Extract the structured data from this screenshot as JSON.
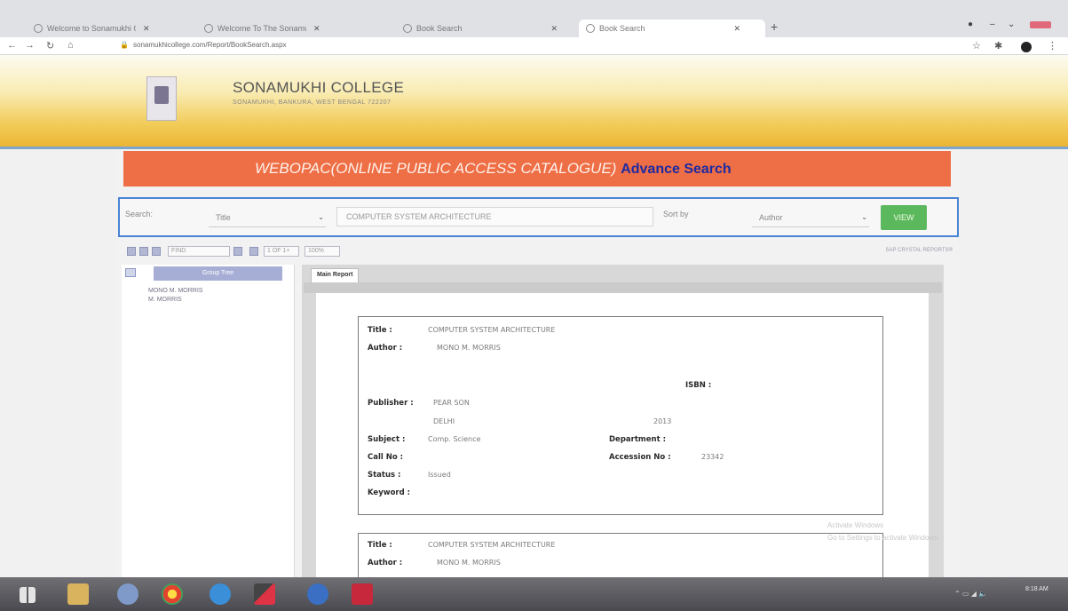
{
  "browser": {
    "tabs": [
      {
        "title": "Welcome to Sonamukhi College"
      },
      {
        "title": "Welcome To The Sonamukhi Co"
      },
      {
        "title": "Book Search"
      },
      {
        "title": "Book Search"
      }
    ],
    "new_tab": "+",
    "url": "sonamukhicollege.com/Report/BookSearch.aspx"
  },
  "college": {
    "name": "SONAMUKHI COLLEGE",
    "address": "SONAMUKHI, BANKURA, WEST BENGAL 722207"
  },
  "banner": {
    "main": "WEBOPAC(ONLINE PUBLIC ACCESS CATALOGUE)",
    "advance": "Advance Search"
  },
  "search": {
    "label": "Search:",
    "field_value": "Title",
    "query": "COMPUTER SYSTEM ARCHITECTURE",
    "sort_label": "Sort by",
    "sort_value": "Author",
    "view_label": "VIEW"
  },
  "report_toolbar": {
    "find": "FIND",
    "page": "1 OF 1+",
    "zoom": "100%",
    "brand": "SAP CRYSTAL REPORTS®"
  },
  "group_tree": {
    "header": "Group Tree",
    "items": [
      "MONO M. MORRIS",
      "M. MORRIS"
    ]
  },
  "report": {
    "tab": "Main Report",
    "labels": {
      "title": "Title :",
      "author": "Author :",
      "isbn": "ISBN :",
      "publisher": "Publisher :",
      "subject": "Subject :",
      "department": "Department :",
      "call_no": "Call No :",
      "accession_no": "Accession No :",
      "status": "Status :",
      "keyword": "Keyword :"
    },
    "records": [
      {
        "title": "COMPUTER SYSTEM ARCHITECTURE",
        "author": "MONO M. MORRIS",
        "publisher": "PEAR SON",
        "place": "DELHI",
        "year": "2013",
        "subject": "Comp. Science",
        "accession_no": "23342",
        "status": "Issued"
      },
      {
        "title": "COMPUTER SYSTEM ARCHITECTURE",
        "author": "MONO M. MORRIS"
      }
    ]
  },
  "watermark": {
    "line1": "Activate Windows",
    "line2": "Go to Settings to activate Windows."
  },
  "taskbar": {
    "time": "8:18 AM"
  }
}
